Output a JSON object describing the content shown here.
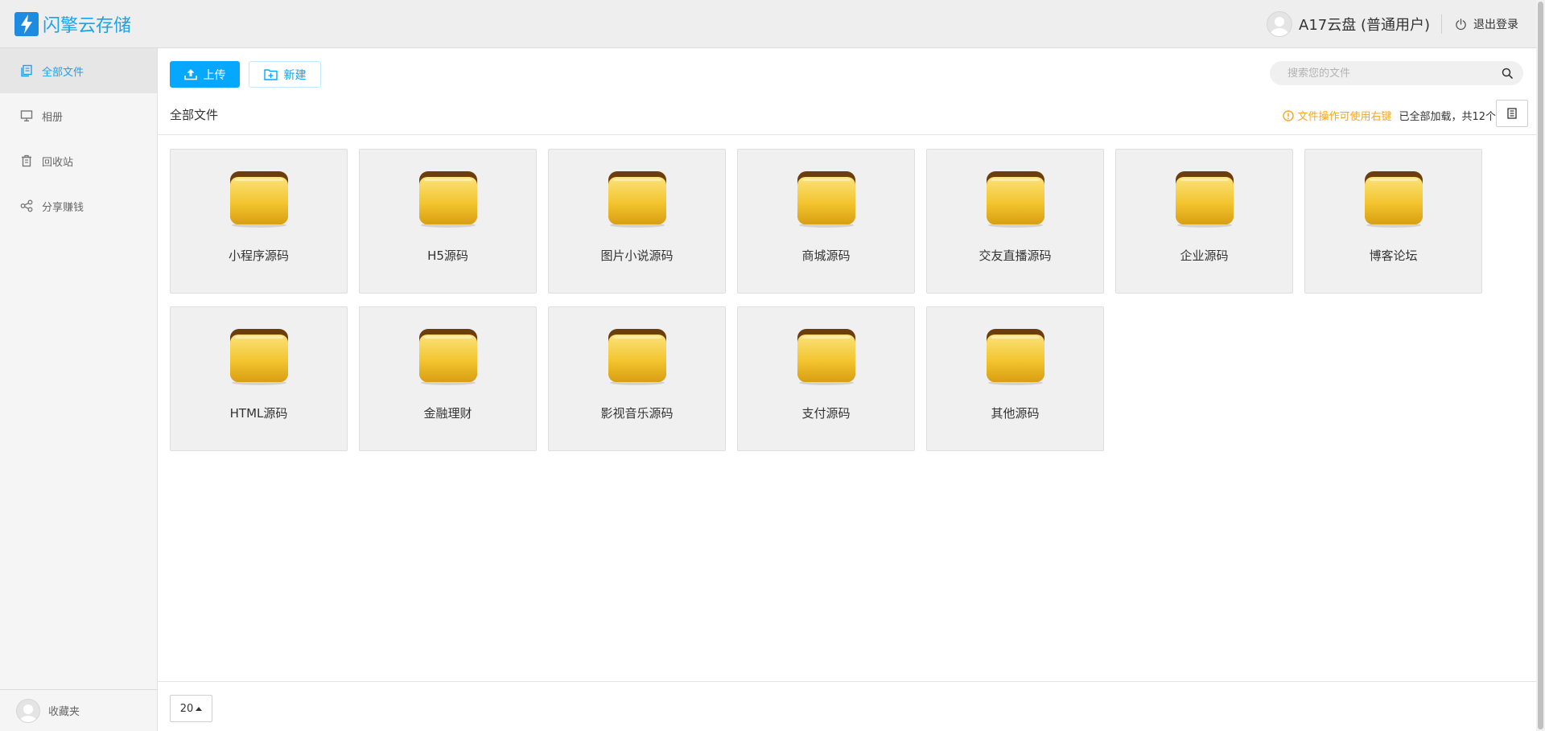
{
  "header": {
    "logo_text": "闪擎云存储",
    "user_name": "A17云盘 (普通用户)",
    "logout_label": "退出登录"
  },
  "sidebar": {
    "items": [
      {
        "label": "全部文件",
        "icon": "files-icon",
        "active": true
      },
      {
        "label": "相册",
        "icon": "monitor-icon",
        "active": false
      },
      {
        "label": "回收站",
        "icon": "trash-icon",
        "active": false
      },
      {
        "label": "分享赚钱",
        "icon": "share-icon",
        "active": false
      }
    ],
    "footer_label": "收藏夹"
  },
  "toolbar": {
    "upload_label": "上传",
    "new_label": "新建"
  },
  "search": {
    "placeholder": "搜索您的文件"
  },
  "breadcrumb": "全部文件",
  "info": {
    "tip": "文件操作可使用右键",
    "count": "已全部加载，共12个"
  },
  "folders": [
    {
      "name": "小程序源码"
    },
    {
      "name": "H5源码"
    },
    {
      "name": "图片小说源码"
    },
    {
      "name": "商城源码"
    },
    {
      "name": "交友直播源码"
    },
    {
      "name": "企业源码"
    },
    {
      "name": "博客论坛"
    },
    {
      "name": "HTML源码"
    },
    {
      "name": "金融理财"
    },
    {
      "name": "影视音乐源码"
    },
    {
      "name": "支付源码"
    },
    {
      "name": "其他源码"
    }
  ],
  "pagination": {
    "page_size": "20"
  },
  "colors": {
    "accent": "#06a7ff",
    "tip": "#f5a623",
    "folder": "#f3c52f"
  }
}
